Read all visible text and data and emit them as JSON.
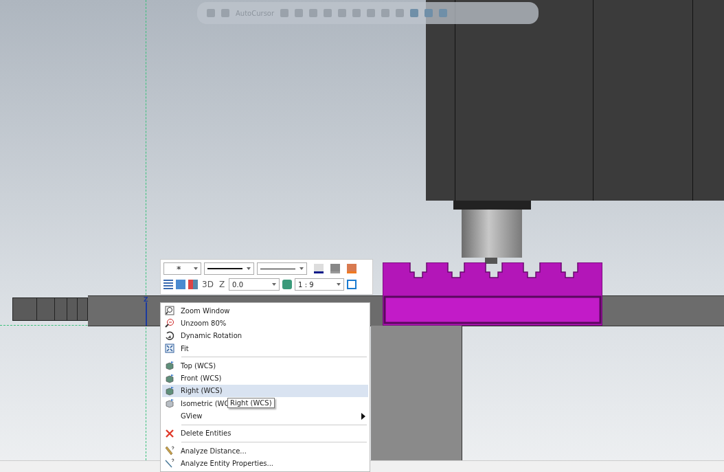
{
  "top_toolbar": {
    "autocursor_label": "AutoCursor"
  },
  "axis_label": "Z",
  "mini_toolbar": {
    "point_style": "*",
    "view_3d": "3D",
    "z_label": "Z",
    "z_value": "0.0",
    "scale": "1 : 9"
  },
  "context_menu": {
    "items": [
      {
        "kind": "item",
        "label": "Zoom Window",
        "selected": false
      },
      {
        "kind": "item",
        "label": "Unzoom 80%",
        "selected": false
      },
      {
        "kind": "item",
        "label": "Dynamic Rotation",
        "selected": false
      },
      {
        "kind": "item",
        "label": "Fit",
        "selected": false
      },
      {
        "kind": "separator"
      },
      {
        "kind": "item",
        "label": "Top (WCS)",
        "selected": false
      },
      {
        "kind": "item",
        "label": "Front (WCS)",
        "selected": false
      },
      {
        "kind": "item",
        "label": "Right (WCS)",
        "selected": true
      },
      {
        "kind": "item",
        "label": "Isometric (WC",
        "selected": false,
        "tooltip": "Right (WCS)"
      },
      {
        "kind": "submenu",
        "label": "GView",
        "selected": false
      },
      {
        "kind": "separator"
      },
      {
        "kind": "item",
        "label": "Delete Entities",
        "selected": false
      },
      {
        "kind": "separator"
      },
      {
        "kind": "item",
        "label": "Analyze Distance...",
        "selected": false
      },
      {
        "kind": "item",
        "label": "Analyze Entity Properties...",
        "selected": false
      }
    ]
  }
}
